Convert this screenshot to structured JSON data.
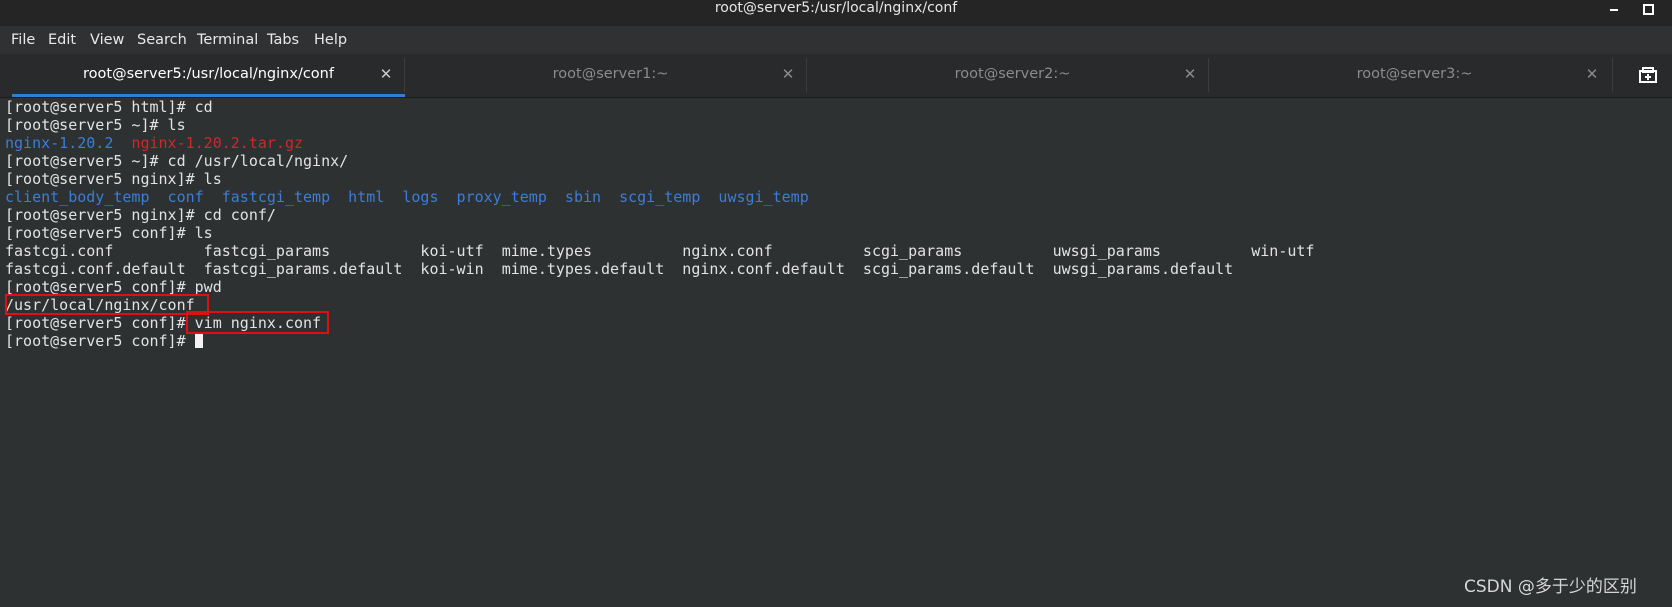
{
  "window": {
    "title": "root@server5:/usr/local/nginx/conf"
  },
  "menu": {
    "items": [
      "File",
      "Edit",
      "View",
      "Search",
      "Terminal",
      "Tabs",
      "Help"
    ]
  },
  "tabs": [
    {
      "label": "root@server5:/usr/local/nginx/conf",
      "active": true
    },
    {
      "label": "root@server1:~",
      "active": false
    },
    {
      "label": "root@server2:~",
      "active": false
    },
    {
      "label": "root@server3:~",
      "active": false
    }
  ],
  "icons": {
    "close": "close-icon",
    "new_tab": "new-tab-icon"
  },
  "colors": {
    "directory": "#3b7dd8",
    "archive": "#d3262b",
    "highlight_box": "#e01010",
    "active_tab_indicator": "#2f7fd6"
  },
  "terminal": {
    "lines": [
      "[root@server5 html]# cd",
      "[root@server5 ~]# ls",
      {
        "segments": [
          {
            "text": "nginx-1.20.2",
            "color": "blue"
          },
          {
            "text": "  "
          },
          {
            "text": "nginx-1.20.2.tar.gz",
            "color": "red"
          }
        ]
      },
      "[root@server5 ~]# cd /usr/local/nginx/",
      "[root@server5 nginx]# ls",
      {
        "segments": [
          {
            "text": "client_body_temp  conf  fastcgi_temp  html  logs  proxy_temp  sbin  scgi_temp  uwsgi_temp",
            "color": "blue"
          }
        ]
      },
      "[root@server5 nginx]# cd conf/",
      "[root@server5 conf]# ls",
      "fastcgi.conf          fastcgi_params          koi-utf  mime.types          nginx.conf          scgi_params          uwsgi_params          win-utf",
      "fastcgi.conf.default  fastcgi_params.default  koi-win  mime.types.default  nginx.conf.default  scgi_params.default  uwsgi_params.default",
      "[root@server5 conf]# pwd",
      "/usr/local/nginx/conf",
      "[root@server5 conf]# vim nginx.conf",
      {
        "segments": [
          {
            "text": "[root@server5 conf]# "
          }
        ],
        "cursor": true
      }
    ]
  },
  "watermark": "CSDN @多于少的区别"
}
